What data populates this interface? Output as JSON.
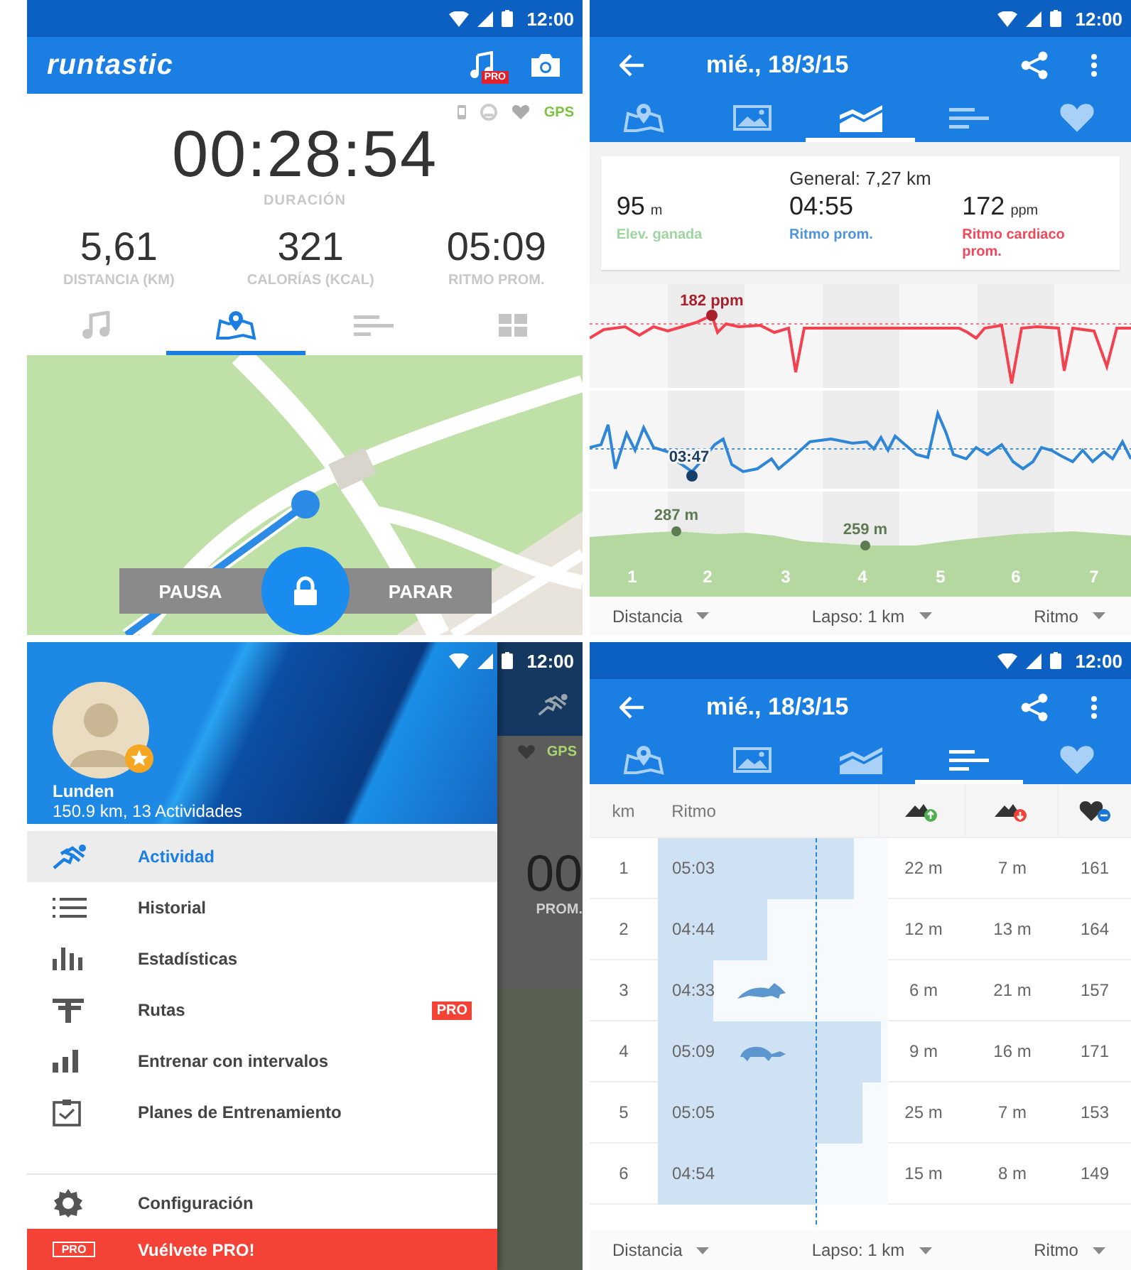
{
  "tracking_screen": {
    "status_bar": {
      "time": "12:00"
    },
    "app_bar": {
      "logo": "runtastic",
      "music_badge": "PRO"
    },
    "sensors": {
      "gps": "GPS"
    },
    "duration": {
      "value": "00:28:54",
      "label": "DURACIÓN"
    },
    "stats": [
      {
        "value": "5,61",
        "label": "DISTANCIA (KM)"
      },
      {
        "value": "321",
        "label": "CALORÍAS (KCAL)"
      },
      {
        "value": "05:09",
        "label": "RITMO PROM."
      }
    ],
    "tabs": [
      {
        "kind": "music",
        "selected": false
      },
      {
        "kind": "map",
        "selected": true
      },
      {
        "kind": "list",
        "selected": false
      },
      {
        "kind": "grid",
        "selected": false
      }
    ],
    "controls": {
      "pause": "PAUSA",
      "stop": "PARAR"
    }
  },
  "chart_screen": {
    "status_bar": {
      "time": "12:00"
    },
    "app_bar": {
      "title": "mié., 18/3/15"
    },
    "tabs": [
      {
        "kind": "map",
        "selected": false
      },
      {
        "kind": "photo",
        "selected": false
      },
      {
        "kind": "chart",
        "selected": true
      },
      {
        "kind": "list",
        "selected": false
      },
      {
        "kind": "heart",
        "selected": false
      }
    ],
    "summary": {
      "title": "General: 7,27 km",
      "stats": [
        {
          "kind": "elevation",
          "value": "95",
          "unit": "m",
          "label": "Elev. ganada"
        },
        {
          "kind": "pace",
          "value": "04:55",
          "label": "Ritmo prom."
        },
        {
          "kind": "heart",
          "value": "172",
          "unit": "ppm",
          "label": "Ritmo cardiaco prom."
        }
      ]
    },
    "chart": {
      "heart_max": "182 ppm",
      "pace_best": "03:47",
      "elevation_max": "287 m",
      "elevation_min": "259 m",
      "km_labels": [
        "1",
        "2",
        "3",
        "4",
        "5",
        "6",
        "7"
      ]
    },
    "filters": [
      "Distancia",
      "Lapso: 1 km",
      "Ritmo"
    ]
  },
  "drawer_screen": {
    "status_bar": {
      "time": "12:00"
    },
    "profile": {
      "name": "Lunden",
      "summary": "150.9 km, 13 Actividades"
    },
    "menu": [
      {
        "kind": "run",
        "label": "Actividad",
        "selected": true
      },
      {
        "kind": "list",
        "label": "Historial",
        "selected": false
      },
      {
        "kind": "stats",
        "label": "Estadísticas",
        "selected": false
      },
      {
        "kind": "route",
        "label": "Rutas",
        "selected": false,
        "badge": "PRO"
      },
      {
        "kind": "intervals",
        "label": "Entrenar con intervalos",
        "selected": false
      },
      {
        "kind": "plans",
        "label": "Planes de Entrenamiento",
        "selected": false
      }
    ],
    "settings": {
      "label": "Configuración"
    },
    "upgrade": {
      "badge": "PRO",
      "label": "Vuélvete PRO!"
    },
    "behind": {
      "gps": "GPS",
      "value": "00",
      "label": "PROM."
    }
  },
  "splits_screen": {
    "status_bar": {
      "time": "12:00"
    },
    "app_bar": {
      "title": "mié., 18/3/15"
    },
    "tabs": [
      {
        "kind": "map",
        "selected": false
      },
      {
        "kind": "photo",
        "selected": false
      },
      {
        "kind": "chart",
        "selected": false
      },
      {
        "kind": "list",
        "selected": true
      },
      {
        "kind": "heart",
        "selected": false
      }
    ],
    "table": {
      "columns": [
        {
          "kind": "km",
          "label": "km"
        },
        {
          "kind": "pace",
          "label": "Ritmo"
        },
        {
          "kind": "ascent"
        },
        {
          "kind": "descent"
        },
        {
          "kind": "heart"
        }
      ],
      "rows": [
        {
          "km": "1",
          "pace": "05:03",
          "level": 0.88,
          "fastest": false,
          "slowest": false,
          "ascent": "22 m",
          "descent": "7 m",
          "heart": "161"
        },
        {
          "km": "2",
          "pace": "04:44",
          "level": 0.49,
          "fastest": false,
          "slowest": false,
          "ascent": "12 m",
          "descent": "13 m",
          "heart": "164"
        },
        {
          "km": "3",
          "pace": "04:33",
          "level": 0.25,
          "fastest": true,
          "slowest": false,
          "ascent": "6 m",
          "descent": "21 m",
          "heart": "157"
        },
        {
          "km": "4",
          "pace": "05:09",
          "level": 1.0,
          "fastest": false,
          "slowest": true,
          "ascent": "9 m",
          "descent": "16 m",
          "heart": "171"
        },
        {
          "km": "5",
          "pace": "05:05",
          "level": 0.92,
          "fastest": false,
          "slowest": false,
          "ascent": "25 m",
          "descent": "7 m",
          "heart": "153"
        },
        {
          "km": "6",
          "pace": "04:54",
          "level": 0.71,
          "fastest": false,
          "slowest": false,
          "ascent": "15 m",
          "descent": "8 m",
          "heart": "149"
        }
      ]
    },
    "filters": [
      "Distancia",
      "Lapso: 1 km",
      "Ritmo"
    ]
  }
}
